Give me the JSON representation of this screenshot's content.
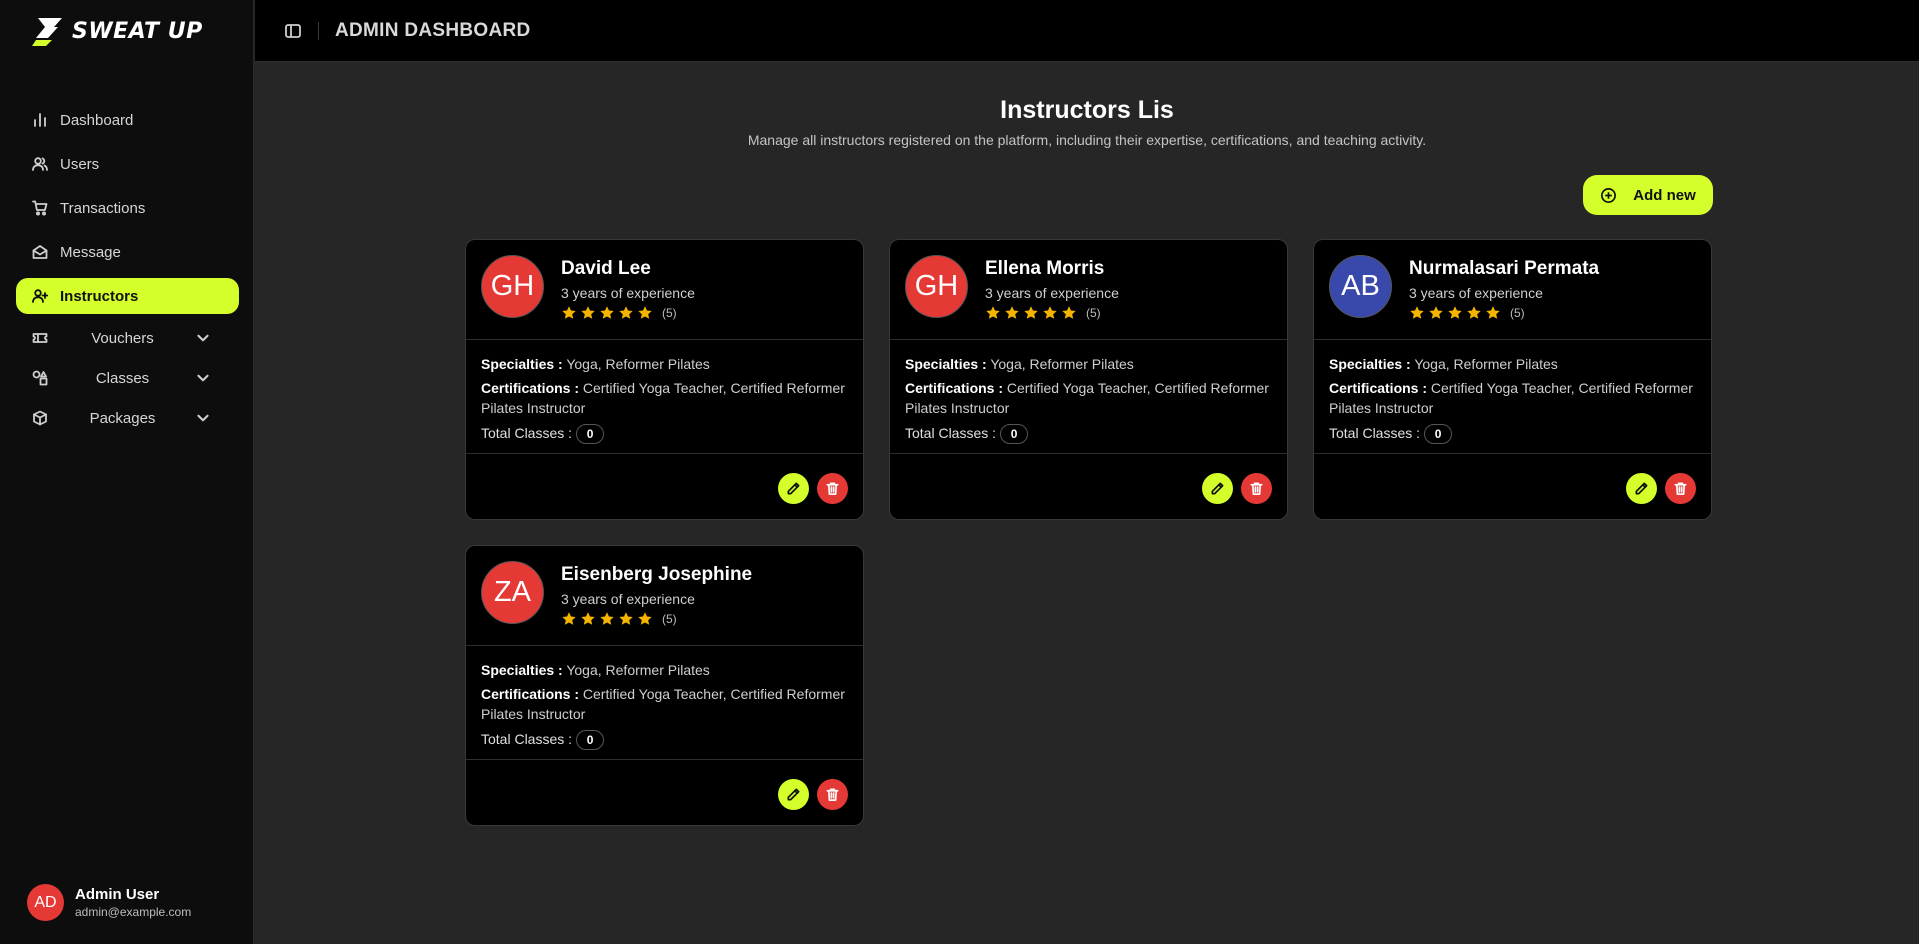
{
  "brand": {
    "name": "SWEAT UP",
    "accent": "#d4ff2a"
  },
  "header": {
    "title": "ADMIN DASHBOARD"
  },
  "sidebar": {
    "items": [
      {
        "label": "Dashboard",
        "icon": "bar-chart-icon",
        "active": false
      },
      {
        "label": "Users",
        "icon": "users-icon",
        "active": false
      },
      {
        "label": "Transactions",
        "icon": "cart-icon",
        "active": false
      },
      {
        "label": "Message",
        "icon": "mail-open-icon",
        "active": false
      },
      {
        "label": "Instructors",
        "icon": "user-plus-icon",
        "active": true
      }
    ],
    "groups": [
      {
        "label": "Vouchers",
        "icon": "ticket-icon"
      },
      {
        "label": "Classes",
        "icon": "shapes-icon"
      },
      {
        "label": "Packages",
        "icon": "package-icon"
      }
    ],
    "user": {
      "initials": "AD",
      "name": "Admin User",
      "email": "admin@example.com"
    }
  },
  "main": {
    "title": "Instructors Lis",
    "subtitle": "Manage all instructors registered on the platform, including their expertise, certifications, and teaching activity.",
    "add_label": "Add new"
  },
  "labels": {
    "specialties": "Specialties :",
    "certifications": "Certifications :",
    "total_classes": "Total Classes :"
  },
  "instructors": [
    {
      "initials": "GH",
      "avatar_color": "#e53935",
      "name": "David Lee",
      "experience": "3 years of experience",
      "rating": 5,
      "rating_count": "(5)",
      "specialties": "Yoga, Reformer Pilates",
      "certifications": "Certified Yoga Teacher, Certified Reformer Pilates Instructor",
      "total_classes": "0"
    },
    {
      "initials": "GH",
      "avatar_color": "#e53935",
      "name": "Ellena Morris",
      "experience": "3 years of experience",
      "rating": 5,
      "rating_count": "(5)",
      "specialties": "Yoga, Reformer Pilates",
      "certifications": "Certified Yoga Teacher, Certified Reformer Pilates Instructor",
      "total_classes": "0"
    },
    {
      "initials": "AB",
      "avatar_color": "#3949ab",
      "name": "Nurmalasari Permata",
      "experience": "3 years of experience",
      "rating": 5,
      "rating_count": "(5)",
      "specialties": "Yoga, Reformer Pilates",
      "certifications": "Certified Yoga Teacher, Certified Reformer Pilates Instructor",
      "total_classes": "0"
    },
    {
      "initials": "ZA",
      "avatar_color": "#e53935",
      "name": "Eisenberg Josephine",
      "experience": "3 years of experience",
      "rating": 5,
      "rating_count": "(5)",
      "specialties": "Yoga, Reformer Pilates",
      "certifications": "Certified Yoga Teacher, Certified Reformer Pilates Instructor",
      "total_classes": "0"
    }
  ]
}
